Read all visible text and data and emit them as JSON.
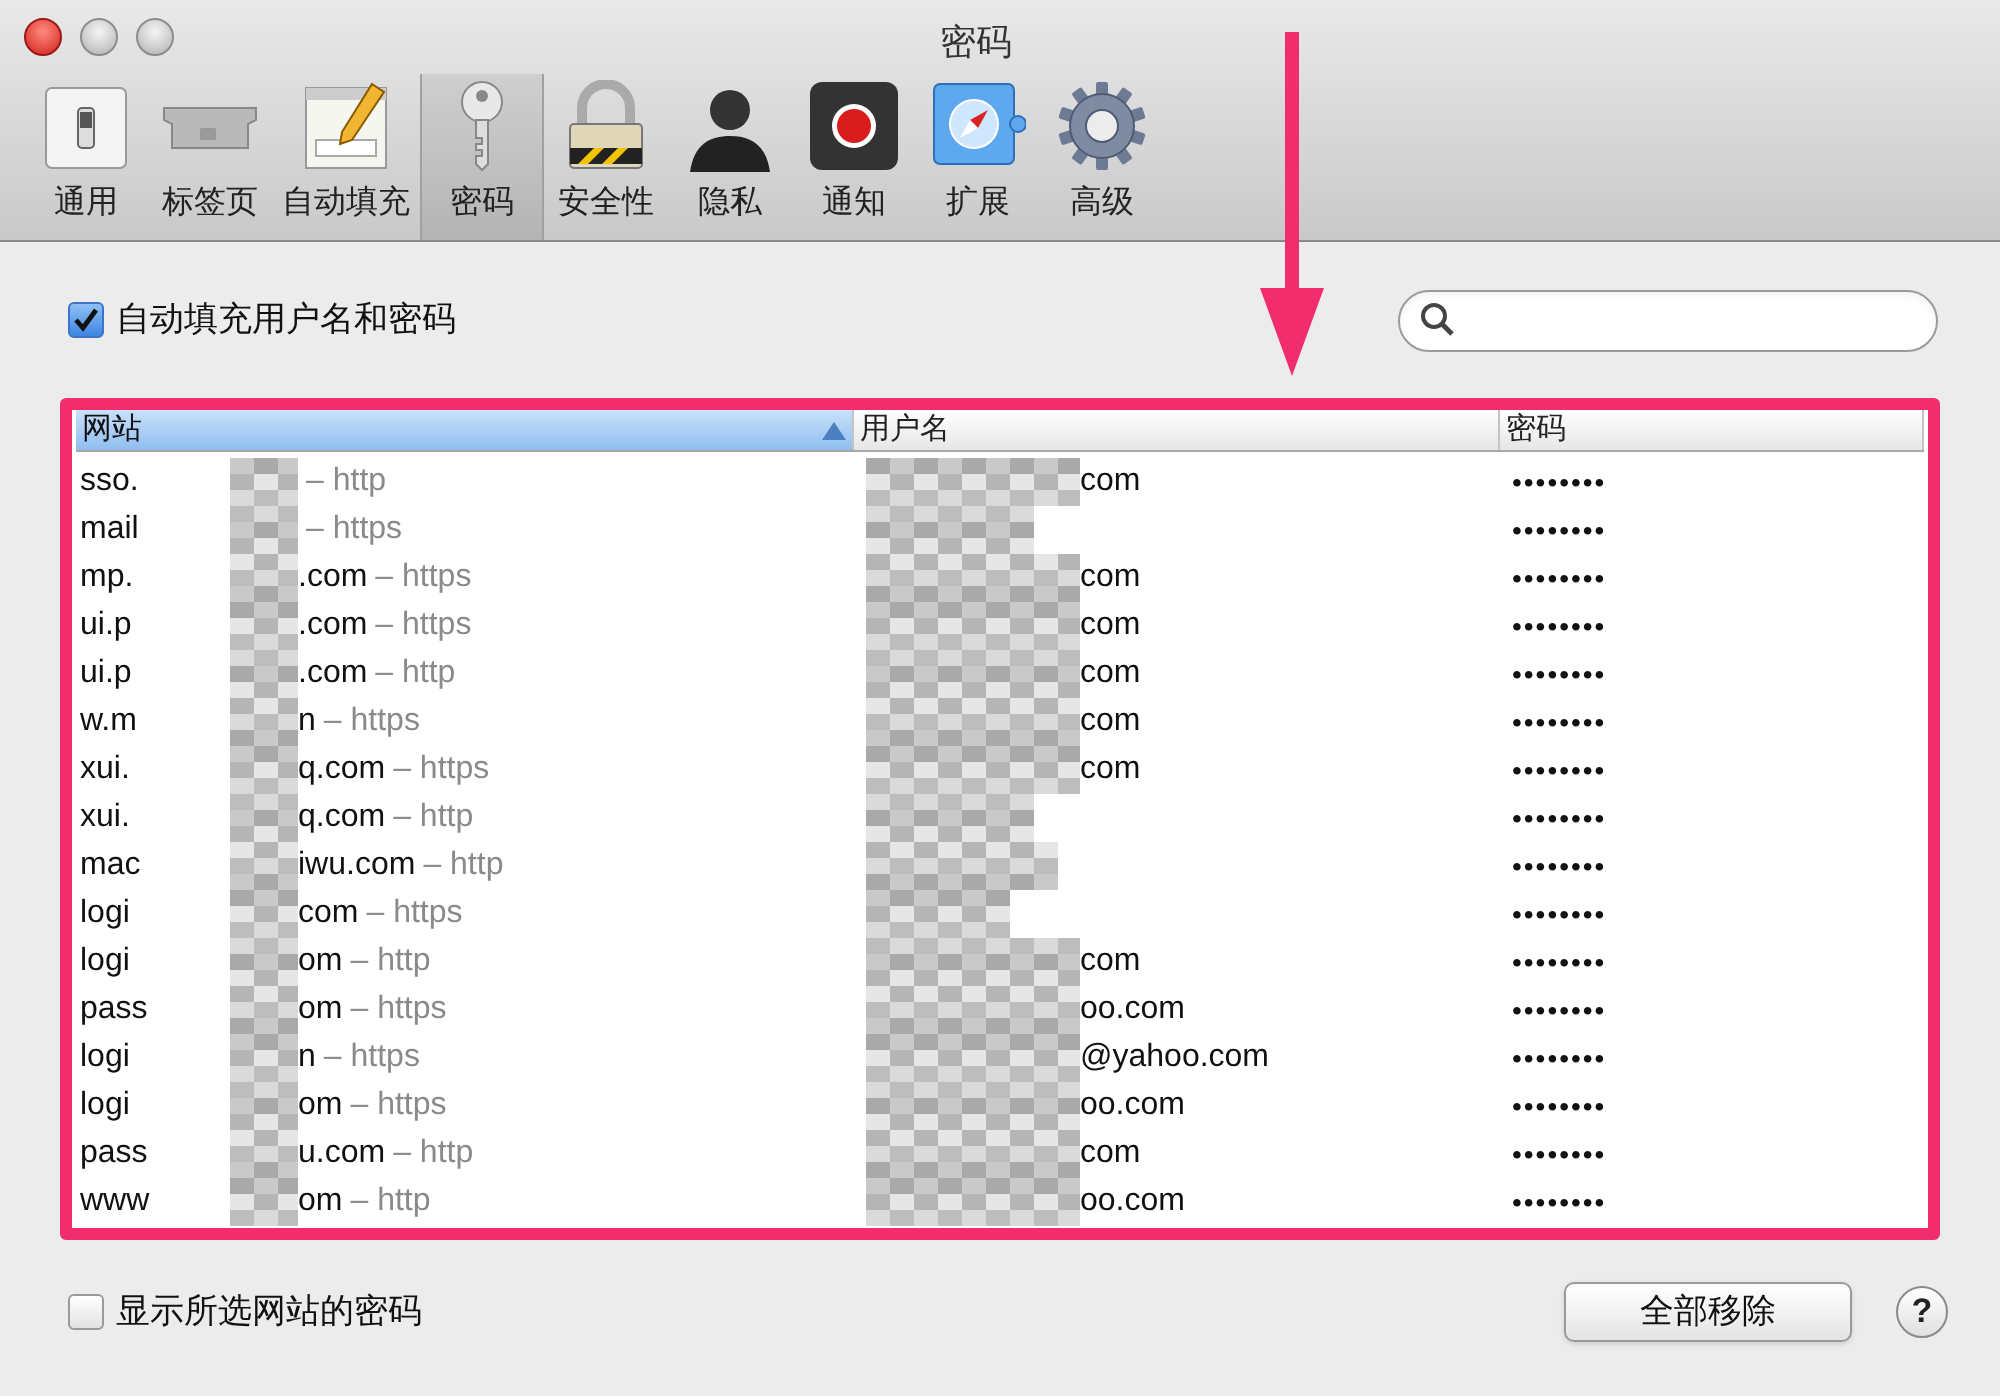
{
  "window": {
    "title": "密码"
  },
  "toolbar": [
    {
      "label": "通用",
      "selected": false
    },
    {
      "label": "标签页",
      "selected": false
    },
    {
      "label": "自动填充",
      "selected": false
    },
    {
      "label": "密码",
      "selected": true
    },
    {
      "label": "安全性",
      "selected": false
    },
    {
      "label": "隐私",
      "selected": false
    },
    {
      "label": "通知",
      "selected": false
    },
    {
      "label": "扩展",
      "selected": false
    },
    {
      "label": "高级",
      "selected": false
    }
  ],
  "autofill": {
    "label": "自动填充用户名和密码",
    "checked": true
  },
  "table": {
    "columns": [
      {
        "label": "网站",
        "selected": true
      },
      {
        "label": "用户名",
        "selected": false
      },
      {
        "label": "密码",
        "selected": false
      }
    ],
    "rows": [
      {
        "site_start": "sso.",
        "protocol": "– http",
        "user_end": "com",
        "password": "••••••••"
      },
      {
        "site_start": "mail",
        "protocol": "– https",
        "password": "••••••••"
      },
      {
        "site_start": "mp.",
        "site_end": ".com",
        "protocol": "– https",
        "user_end": "com",
        "password": "••••••••"
      },
      {
        "site_start": "ui.p",
        "site_end": ".com",
        "protocol": "– https",
        "user_end": "com",
        "password": "••••••••"
      },
      {
        "site_start": "ui.p",
        "site_end": ".com",
        "protocol": "– http",
        "user_end": "com",
        "password": "••••••••"
      },
      {
        "site_start": "w.m",
        "site_end": "n",
        "protocol": "– https",
        "user_end": "com",
        "password": "••••••••"
      },
      {
        "site_start": "xui.",
        "site_end": "q.com",
        "protocol": "– https",
        "user_end": "com",
        "password": "••••••••"
      },
      {
        "site_start": "xui.",
        "site_end": "q.com",
        "protocol": "– http",
        "password": "••••••••"
      },
      {
        "site_start": "mac",
        "site_end": "iwu.com",
        "protocol": "– http",
        "password": "••••••••"
      },
      {
        "site_start": "logi",
        "site_end": "com",
        "protocol": "– https",
        "password": "••••••••"
      },
      {
        "site_start": "logi",
        "site_end": "om",
        "protocol": "– http",
        "user_end": "com",
        "password": "••••••••"
      },
      {
        "site_start": "pass",
        "site_end": "om",
        "protocol": "– https",
        "user_end": "oo.com",
        "password": "••••••••"
      },
      {
        "site_start": "logi",
        "site_end": "n",
        "protocol": "– https",
        "user_end": "@yahoo.com",
        "password": "••••••••"
      },
      {
        "site_start": "logi",
        "site_end": "om",
        "protocol": "– https",
        "user_end": "oo.com",
        "password": "••••••••"
      },
      {
        "site_start": "pass",
        "site_end": "u.com",
        "protocol": "– http",
        "user_end": "com",
        "password": "••••••••"
      },
      {
        "site_start": "www",
        "site_end": "om",
        "protocol": "– http",
        "user_end": "oo.com",
        "password": "••••••••"
      }
    ]
  },
  "show_passwords": {
    "label": "显示所选网站的密码",
    "checked": false
  },
  "remove_all_button": "全部移除",
  "help_button": "?"
}
